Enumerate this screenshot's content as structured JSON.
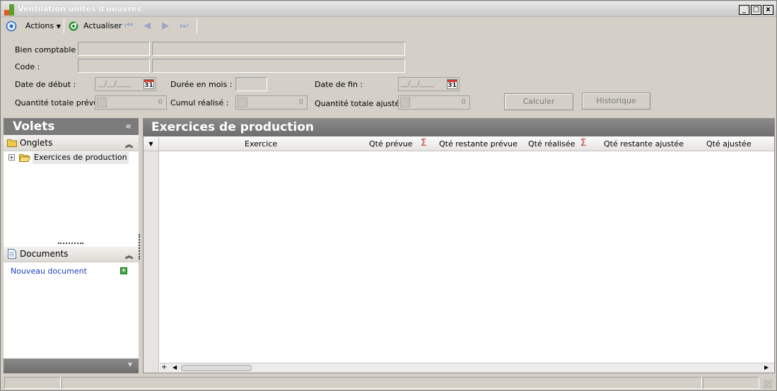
{
  "window": {
    "title": "Ventilation unités d'oeuvres",
    "minimize": "_",
    "maximize": "□",
    "close": "x"
  },
  "toolbar": {
    "actions_label": "Actions",
    "refresh_label": "Actualiser"
  },
  "form": {
    "bien_comptable_label": "Bien comptable :",
    "code_label": "Code :",
    "date_debut_label": "Date de début :",
    "date_debut_value": "__/__/____",
    "duree_label": "Durée en mois :",
    "date_fin_label": "Date de fin :",
    "date_fin_value": "__/__/____",
    "calendar_glyph": "31",
    "qte_totale_prevue_label": "Quantité totale prévue :",
    "qte_totale_prevue_value": "0",
    "cumul_realise_label": "Cumul réalisé :",
    "cumul_realise_value": "0",
    "qte_totale_ajustee_label": "Quantité totale ajustée :",
    "qte_totale_ajustee_value": "0",
    "calculer_label": "Calculer",
    "historique_label": "Historique"
  },
  "left_panel": {
    "title": "Volets",
    "collapse_glyph": "«",
    "onglets_label": "Onglets",
    "tree_item": "Exercices de production",
    "tree_expander": "+",
    "documents_label": "Documents",
    "new_document_label": "Nouveau document",
    "chevron": "⌃"
  },
  "main": {
    "title": "Exercices de production",
    "columns": [
      "Exercice",
      "Qté prévue",
      "Qté restante prévue",
      "Qté réalisée",
      "Qté restante ajustée",
      "Qté ajustée"
    ],
    "sigma": "Σ"
  },
  "colors": {
    "accent": "#2a6fc7",
    "header_gray": "#7b7b7b",
    "link": "#1f3fc0",
    "sigma": "#c0302a"
  },
  "icons": [
    "app-icon",
    "actions-icon",
    "refresh-icon",
    "first-icon",
    "prev-icon",
    "next-icon",
    "last-icon",
    "folder-icon",
    "document-icon",
    "add-icon",
    "calendar-icon"
  ]
}
